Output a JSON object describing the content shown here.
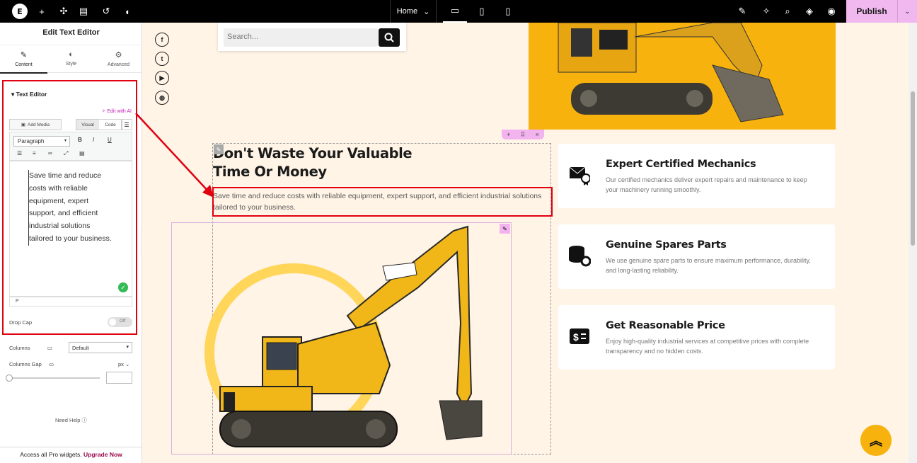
{
  "topbar": {
    "page_selector": "Home",
    "publish_label": "Publish"
  },
  "panel": {
    "title": "Edit Text Editor",
    "tabs": [
      {
        "label": "Content",
        "icon": "pencil-icon"
      },
      {
        "label": "Style",
        "icon": "half-circle-icon"
      },
      {
        "label": "Advanced",
        "icon": "gear-icon"
      }
    ],
    "section_title": "Text Editor",
    "edit_ai": "Edit with AI",
    "add_media": "Add Media",
    "visual_tab": "Visual",
    "code_tab": "Code",
    "format_select": "Paragraph",
    "editor_text": "Save time and reduce costs with reliable equipment, expert support, and efficient industrial solutions tailored to your business.",
    "path_label": "P",
    "drop_cap_label": "Drop Cap",
    "drop_cap_toggle": "Off",
    "columns_label": "Columns",
    "columns_value": "Default",
    "columns_gap_label": "Columns Gap",
    "columns_gap_unit": "px",
    "need_help": "Need Help",
    "promo_text": "Access all Pro widgets.",
    "promo_link": "Upgrade Now"
  },
  "canvas": {
    "search_placeholder": "Search...",
    "heading_line1": "Don't Waste Your Valuable",
    "heading_line2": "Time Or Money",
    "subtext": "Save time and reduce costs with reliable equipment, expert support, and efficient industrial solutions tailored to your business.",
    "cards": [
      {
        "title": "Expert Certified Mechanics",
        "desc": "Our certified mechanics deliver expert repairs and maintenance to keep your machinery running smoothly.",
        "icon": "certificate-icon"
      },
      {
        "title": "Genuine Spares Parts",
        "desc": "We use genuine spare parts to ensure maximum performance, durability, and long-lasting reliability.",
        "icon": "gears-icon"
      },
      {
        "title": "Get Reasonable Price",
        "desc": "Enjoy high-quality industrial services at competitive prices with complete transparency and no hidden costs.",
        "icon": "price-tag-icon"
      }
    ]
  },
  "colors": {
    "accent": "#f7b20d",
    "publish": "#f0b8ee",
    "highlight": "#e0000f",
    "canvas_bg": "#fff4e6"
  }
}
